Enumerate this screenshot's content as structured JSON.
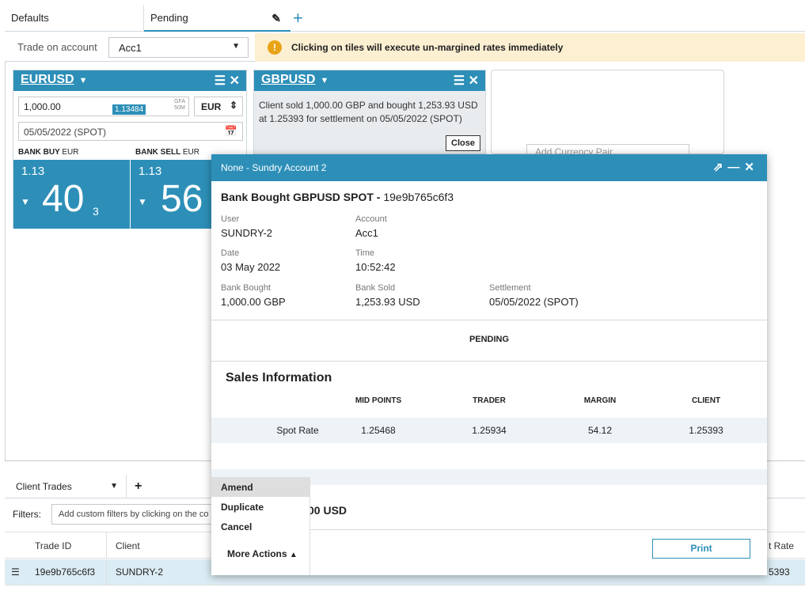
{
  "top_tabs": {
    "defaults": "Defaults",
    "pending": "Pending",
    "edit_icon": "pencil-icon",
    "add": "+"
  },
  "account_bar": {
    "label": "Trade on account",
    "account": "Acc1",
    "warning": "Clicking on tiles will execute un-margined rates immediately"
  },
  "eur_tile": {
    "pair": "EURUSD",
    "amount": "1,000.00",
    "gfa_line1": "GFA",
    "gfa_line2": "50M",
    "currency": "EUR",
    "date": "05/05/2022 (SPOT)",
    "buy_label": "BANK BUY",
    "sell_label": "BANK SELL",
    "label_ccy": "EUR",
    "buy_big": "1.13",
    "buy_pips": "40",
    "buy_frac": "3",
    "sell_big": "1.13",
    "sell_pips": "56",
    "mid": "1.13484"
  },
  "gbp_tile": {
    "pair": "GBPUSD",
    "message": "Client sold 1,000.00 GBP and bought 1,253.93 USD at 1.25393 for settlement on 05/05/2022 (SPOT)",
    "close": "Close"
  },
  "empty_tile": {
    "placeholder": "Add Currency Pair"
  },
  "client_trades": {
    "tab": "Client Trades",
    "add": "+",
    "filters_label": "Filters:",
    "filters_placeholder": "Add custom filters by clicking on the co",
    "headers": {
      "trade_id": "Trade ID",
      "client": "Client",
      "rate": "t Rate"
    },
    "row": {
      "trade_id": "19e9b765c6f3",
      "client": "SUNDRY-2",
      "rate": "5393"
    }
  },
  "modal": {
    "title": "None - Sundry Account 2",
    "heading": "Bank Bought GBPUSD SPOT -",
    "trade_id": "19e9b765c6f3",
    "fields": {
      "user_label": "User",
      "user": "SUNDRY-2",
      "account_label": "Account",
      "account": "Acc1",
      "date_label": "Date",
      "date": "03 May 2022",
      "time_label": "Time",
      "time": "10:52:42",
      "bought_label": "Bank Bought",
      "bought": "1,000.00 GBP",
      "sold_label": "Bank Sold",
      "sold": "1,253.93 USD",
      "settle_label": "Settlement",
      "settle": "05/05/2022 (SPOT)"
    },
    "status": "PENDING",
    "sales": {
      "title": "Sales Information",
      "cols": [
        "MID POINTS",
        "TRADER",
        "MARGIN",
        "CLIENT"
      ],
      "row_label": "Spot Rate",
      "values": [
        "1.25468",
        "1.25934",
        "54.12",
        "1.25393"
      ]
    },
    "partial_total": "00 USD",
    "print": "Print"
  },
  "menu": {
    "items": [
      "Amend",
      "Duplicate",
      "Cancel"
    ],
    "more": "More Actions"
  },
  "colors": {
    "accent": "#2d8fb8",
    "warning_bg": "#fcefd2",
    "warning_icon": "#e8a317"
  }
}
